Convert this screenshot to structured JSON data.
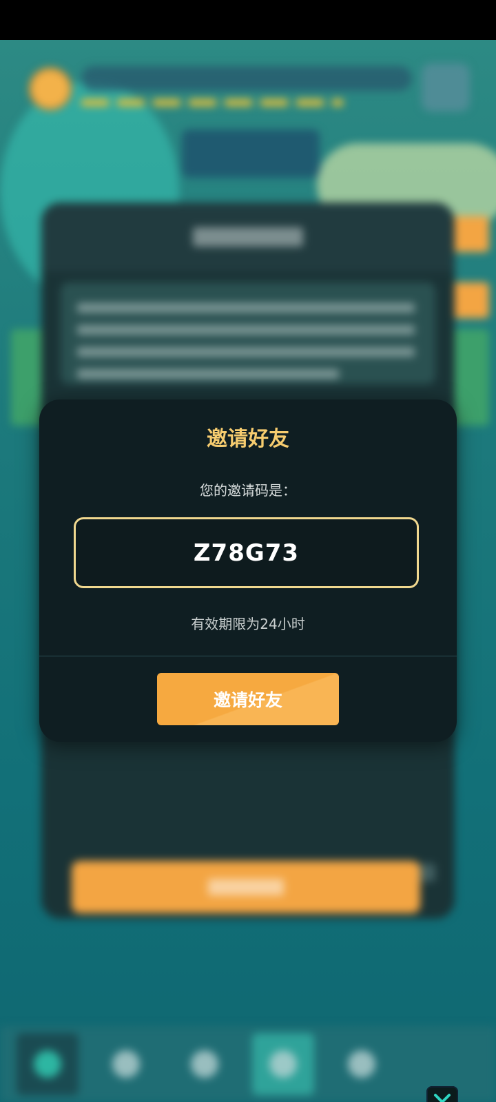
{
  "modal": {
    "title": "邀请好友",
    "subtitle": "您的邀请码是：",
    "invite_code": "Z78G73",
    "validity_note": "有效期限为24小时",
    "invite_button_label": "邀请好友"
  },
  "colors": {
    "title": "#f6cc6f",
    "code_border": "#f0d88f",
    "button": "#f6a940",
    "modal_bg": "#0f1e22"
  },
  "icons": {
    "close": "close-icon"
  }
}
